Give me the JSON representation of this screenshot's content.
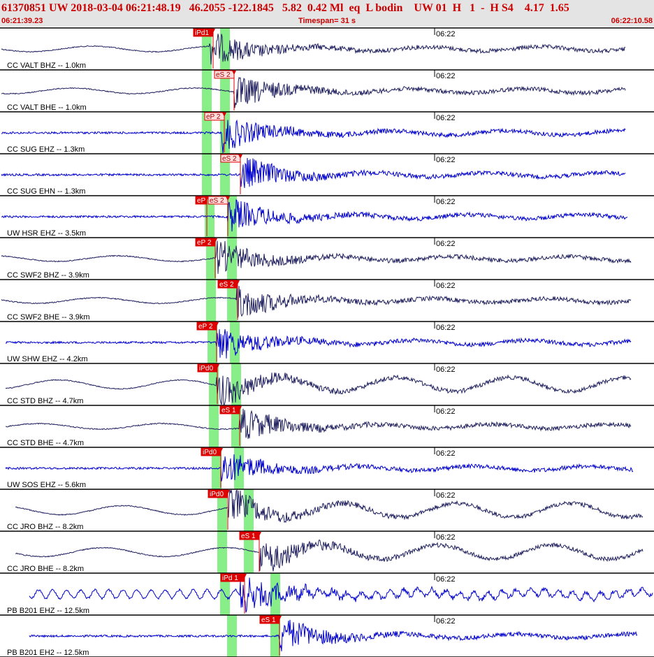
{
  "header": {
    "title": "61370851 UW 2018-03-04 06:21:48.19   46.2055 -122.1845   5.82  0.42 Ml  eq  L bodin    UW 01  H   1  -  H S4    4.17  1.65",
    "start_time": "06:21:39.23",
    "timespan": "Timespan=  31 s",
    "end_time": "06:22:10.58"
  },
  "time_tick_label": "06:22",
  "colors": {
    "header_text": "#cc0000",
    "header_bg": "#e4e4e4",
    "dark_trace": "#202060",
    "blue_trace": "#0000cc",
    "pick_fill": "#dd0000",
    "pick_text": "#ffffff",
    "window_band": "#88ee88"
  },
  "channels": [
    {
      "label": "CC VALT BHZ -- 1.0km",
      "trace": "dark",
      "picks": [
        {
          "label": "iPd1",
          "filled": true
        }
      ],
      "bands": [
        0.08,
        0.04
      ]
    },
    {
      "label": "CC VALT BHE -- 1.0km",
      "trace": "dark",
      "picks": [
        {
          "label": "eS 2",
          "filled": false
        }
      ],
      "bands": [
        0.04,
        0.08
      ]
    },
    {
      "label": "CC SUG EHZ -- 1.3km",
      "trace": "blue",
      "picks": [
        {
          "label": "eP 2",
          "filled": false
        }
      ],
      "bands": [
        0.06,
        0.06
      ]
    },
    {
      "label": "CC SUG EHN -- 1.3km",
      "trace": "blue",
      "picks": [
        {
          "label": "eS 2",
          "filled": false
        }
      ],
      "bands": [
        0.06,
        0.06
      ]
    },
    {
      "label": "UW HSR EHZ -- 3.5km",
      "trace": "blue",
      "picks": [
        {
          "label": "eP",
          "filled": true
        },
        {
          "label": "eS 2",
          "filled": false
        }
      ],
      "bands": [
        0.1,
        0.1
      ]
    },
    {
      "label": "CC SWF2 BHZ -- 3.9km",
      "trace": "dark",
      "picks": [
        {
          "label": "eP 2",
          "filled": true
        }
      ],
      "bands": [
        0.12,
        0.12
      ]
    },
    {
      "label": "CC SWF2 BHE -- 3.9km",
      "trace": "dark",
      "picks": [
        {
          "label": "eS 2",
          "filled": true
        }
      ],
      "bands": [
        0.12,
        0.12
      ]
    },
    {
      "label": "UW SHW EHZ -- 4.2km",
      "trace": "blue",
      "picks": [
        {
          "label": "eP 2",
          "filled": true
        }
      ],
      "bands": [
        0.14,
        0.14
      ]
    },
    {
      "label": "CC STD BHZ -- 4.7km",
      "trace": "dark",
      "picks": [
        {
          "label": "iPd0",
          "filled": true
        }
      ],
      "bands": [
        0.16,
        0.16
      ]
    },
    {
      "label": "CC STD BHE -- 4.7km",
      "trace": "dark",
      "picks": [
        {
          "label": "eS 1",
          "filled": true
        }
      ],
      "bands": [
        0.16,
        0.16
      ]
    },
    {
      "label": "UW SOS EHZ -- 5.6km",
      "trace": "blue",
      "picks": [
        {
          "label": "iPd0",
          "filled": true
        }
      ],
      "bands": [
        0.2,
        0.2
      ]
    },
    {
      "label": "CC JRO BHZ -- 8.2km",
      "trace": "dark",
      "picks": [
        {
          "label": "iPd0",
          "filled": true
        }
      ],
      "bands": [
        0.3,
        0.3
      ]
    },
    {
      "label": "CC JRO BHE -- 8.2km",
      "trace": "dark",
      "picks": [
        {
          "label": "eS 1",
          "filled": true
        }
      ],
      "bands": [
        0.3,
        0.3
      ]
    },
    {
      "label": "PB B201 EHZ -- 12.5km",
      "trace": "blue",
      "picks": [
        {
          "label": "iPd 1",
          "filled": true
        }
      ],
      "bands": [
        0.5,
        0.5
      ]
    },
    {
      "label": "PB B201 EH2 -- 12.5km",
      "trace": "blue",
      "picks": [
        {
          "label": "eS 1",
          "filled": true
        }
      ],
      "bands": [
        0.5,
        0.5
      ]
    }
  ]
}
